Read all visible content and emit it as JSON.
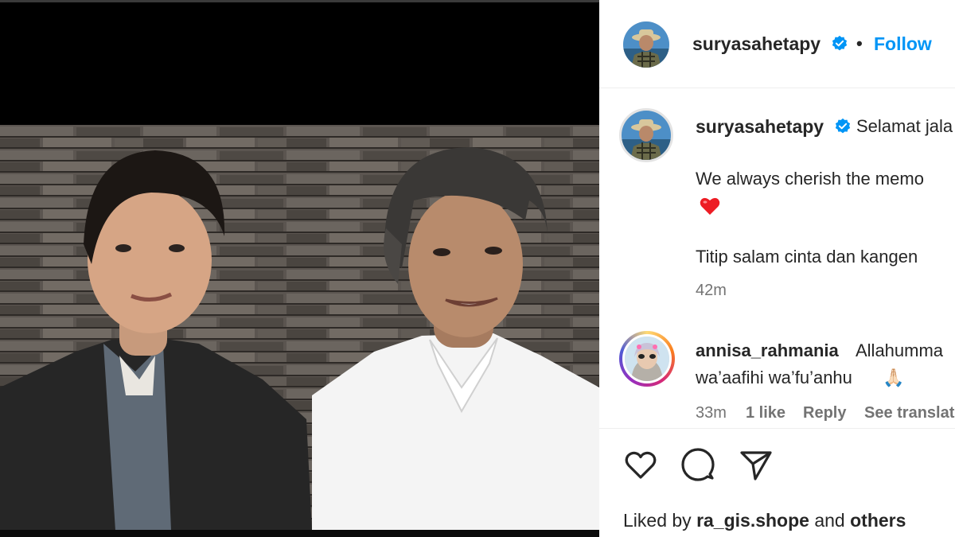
{
  "post": {
    "author": "suryasahetapy",
    "follow_label": "Follow",
    "separator": "•"
  },
  "caption": {
    "author": "suryasahetapy",
    "line1": "Selamat jala",
    "line2": "We always cherish the memo",
    "heart": "❤️",
    "line3": "Titip salam cinta dan kangen",
    "time": "42m"
  },
  "comment": {
    "author": "annisa_rahmania",
    "line1": "Allahumma",
    "line2": "wa’aafihi wa’fu’anhu",
    "emoji": "🙏🏻",
    "time": "33m",
    "likes": "1 like",
    "reply_label": "Reply",
    "translate_label": "See translat"
  },
  "footer": {
    "liked_prefix": "Liked by",
    "liked_user": "ra_gis.shope",
    "liked_and": "and",
    "liked_others": "others"
  },
  "icons": {
    "like": "heart-icon",
    "comment": "comment-icon",
    "share": "paper-plane-icon",
    "verified": "verified-badge-icon"
  },
  "colors": {
    "link": "#0095f6",
    "verified": "#0095f6",
    "muted": "#737373",
    "heart": "#ed4956"
  }
}
